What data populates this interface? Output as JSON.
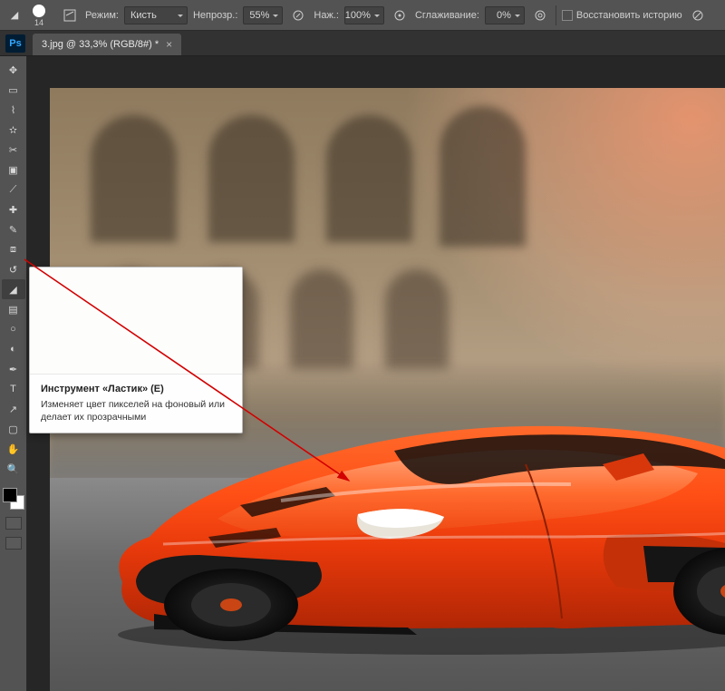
{
  "options": {
    "brush_size": "14",
    "mode_label": "Режим:",
    "mode_value": "Кисть",
    "opacity_label": "Непрозр.:",
    "opacity_value": "55%",
    "pressure_label": "Наж.:",
    "pressure_value": "100%",
    "smoothing_label": "Сглаживание:",
    "smoothing_value": "0%",
    "restore_label": "Восстановить историю"
  },
  "tab": {
    "title": "3.jpg @ 33,3% (RGB/8#) *"
  },
  "ps_logo": "Ps",
  "tools": [
    {
      "name": "move-tool",
      "glyph": "✥"
    },
    {
      "name": "marquee-tool",
      "glyph": "▭"
    },
    {
      "name": "lasso-tool",
      "glyph": "⌇"
    },
    {
      "name": "quick-select-tool",
      "glyph": "✫"
    },
    {
      "name": "crop-tool",
      "glyph": "✂"
    },
    {
      "name": "frame-tool",
      "glyph": "▣"
    },
    {
      "name": "eyedropper-tool",
      "glyph": "⟋"
    },
    {
      "name": "healing-brush-tool",
      "glyph": "✚"
    },
    {
      "name": "brush-tool",
      "glyph": "✎"
    },
    {
      "name": "clone-stamp-tool",
      "glyph": "⧈"
    },
    {
      "name": "history-brush-tool",
      "glyph": "↺"
    },
    {
      "name": "eraser-tool",
      "glyph": "◢",
      "active": true
    },
    {
      "name": "gradient-tool",
      "glyph": "▤"
    },
    {
      "name": "blur-tool",
      "glyph": "○"
    },
    {
      "name": "dodge-tool",
      "glyph": "◐"
    },
    {
      "name": "pen-tool",
      "glyph": "✒"
    },
    {
      "name": "type-tool",
      "glyph": "T"
    },
    {
      "name": "path-select-tool",
      "glyph": "↗"
    },
    {
      "name": "rectangle-tool",
      "glyph": "▢"
    },
    {
      "name": "hand-tool",
      "glyph": "✋"
    },
    {
      "name": "zoom-tool",
      "glyph": "🔍"
    }
  ],
  "tooltip": {
    "title": "Инструмент «Ластик» (E)",
    "desc": "Изменяет цвет пикселей на фоновый или делает их прозрачными"
  }
}
